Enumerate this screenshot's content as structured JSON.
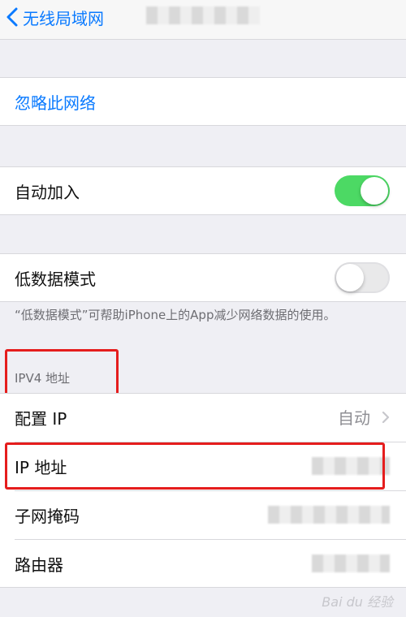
{
  "navbar": {
    "back_label": "无线局域网"
  },
  "forget_network": {
    "label": "忽略此网络"
  },
  "auto_join": {
    "label": "自动加入",
    "enabled": true
  },
  "low_data_mode": {
    "label": "低数据模式",
    "enabled": false,
    "description": "“低数据模式”可帮助iPhone上的App减少网络数据的使用。"
  },
  "ipv4": {
    "header": "IPV4 地址",
    "rows": [
      {
        "label": "配置 IP",
        "value": "自动"
      },
      {
        "label": "IP 地址"
      },
      {
        "label": "子网掩码"
      },
      {
        "label": "路由器"
      }
    ]
  },
  "watermark": "Bai du 经验",
  "colors": {
    "accent": "#0a7aff",
    "toggle_on": "#4cd964",
    "highlight": "#e51d1d",
    "background": "#efeff4"
  }
}
